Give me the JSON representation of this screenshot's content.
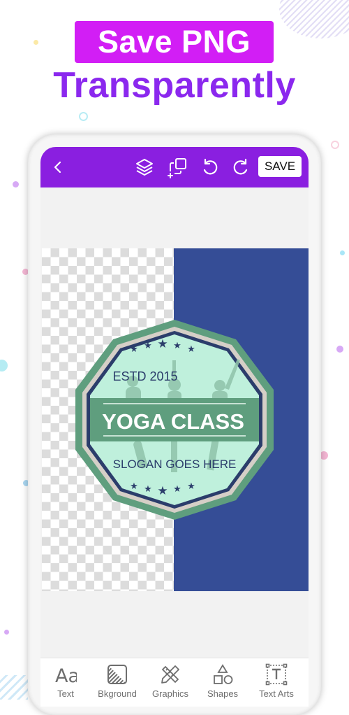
{
  "promo": {
    "badge_text": "Save PNG",
    "subtitle": "Transparently",
    "badge_color": "#d21ef5",
    "subtitle_color": "#8b28ee"
  },
  "toolbar": {
    "back_icon": "chevron-left-icon",
    "layers_icon": "layers-icon",
    "duplicate_icon": "duplicate-icon",
    "undo_icon": "undo-icon",
    "redo_icon": "redo-icon",
    "save_label": "SAVE",
    "color": "#8a1fe0"
  },
  "canvas": {
    "background_color": "#354d96",
    "logo": {
      "top_text": "ESTD 2015",
      "title": "YOGA CLASS",
      "slogan": "SLOGAN GOES HERE"
    }
  },
  "bottom_tools": [
    {
      "label": "Text",
      "icon": "text-aa-icon"
    },
    {
      "label": "Bkground",
      "icon": "background-icon"
    },
    {
      "label": "Graphics",
      "icon": "graphics-pencil-ruler-icon"
    },
    {
      "label": "Shapes",
      "icon": "shapes-icon"
    },
    {
      "label": "Text Arts",
      "icon": "text-arts-icon"
    }
  ]
}
